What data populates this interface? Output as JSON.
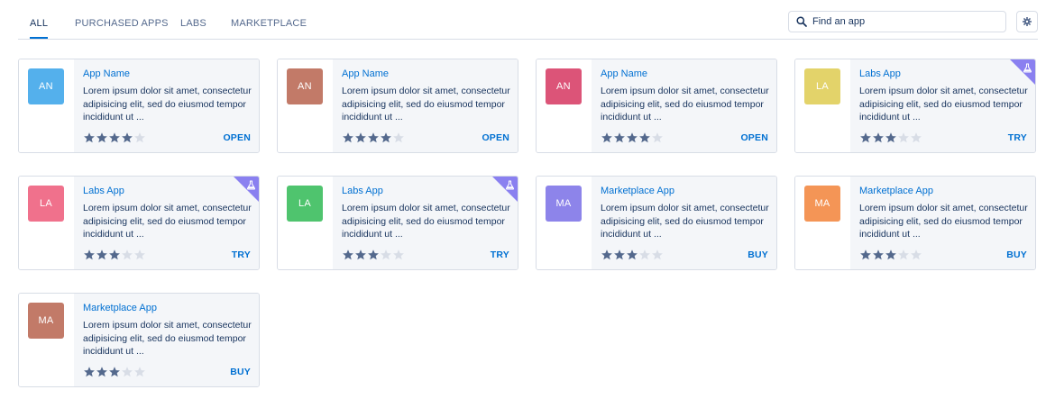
{
  "tabs": [
    {
      "label": "ALL",
      "active": true
    },
    {
      "label": "PURCHASED APPS",
      "active": false
    },
    {
      "label": "LABS",
      "active": false
    },
    {
      "label": "MARKETPLACE",
      "active": false
    }
  ],
  "search": {
    "placeholder": "Find an app"
  },
  "icons": {
    "search": "search-icon",
    "settings": "gear-icon",
    "labs_badge": "flask-icon",
    "rating": "star-icon"
  },
  "colors": {
    "accent": "#0070d2",
    "star_filled": "#54698d",
    "star_empty": "#d8dde6",
    "labs_badge": "#8a80f0"
  },
  "cards": [
    {
      "initials": "AN",
      "color": "#54b0ec",
      "name": "App Name",
      "description": "Lorem ipsum dolor sit amet, consectetur adipisicing elit, sed do eiusmod tempor incididunt ut ...",
      "rating": 4,
      "max_rating": 5,
      "action": "OPEN",
      "labs": false
    },
    {
      "initials": "AN",
      "color": "#c27a68",
      "name": "App Name",
      "description": "Lorem ipsum dolor sit amet, consectetur adipisicing elit, sed do eiusmod tempor incididunt ut ...",
      "rating": 4,
      "max_rating": 5,
      "action": "OPEN",
      "labs": false
    },
    {
      "initials": "AN",
      "color": "#dc5478",
      "name": "App Name",
      "description": "Lorem ipsum dolor sit amet, consectetur adipisicing elit, sed do eiusmod tempor incididunt ut ...",
      "rating": 4,
      "max_rating": 5,
      "action": "OPEN",
      "labs": false
    },
    {
      "initials": "LA",
      "color": "#e3d36a",
      "name": "Labs App",
      "description": "Lorem ipsum dolor sit amet, consectetur adipisicing elit, sed do eiusmod tempor incididunt ut ...",
      "rating": 3,
      "max_rating": 5,
      "action": "TRY",
      "labs": true
    },
    {
      "initials": "LA",
      "color": "#f0718c",
      "name": "Labs App",
      "description": "Lorem ipsum dolor sit amet, consectetur adipisicing elit, sed do eiusmod tempor incididunt ut ...",
      "rating": 3,
      "max_rating": 5,
      "action": "TRY",
      "labs": true
    },
    {
      "initials": "LA",
      "color": "#4fc46e",
      "name": "Labs App",
      "description": "Lorem ipsum dolor sit amet, consectetur adipisicing elit, sed do eiusmod tempor incididunt ut ...",
      "rating": 3,
      "max_rating": 5,
      "action": "TRY",
      "labs": true
    },
    {
      "initials": "MA",
      "color": "#8d84ea",
      "name": "Marketplace App",
      "description": "Lorem ipsum dolor sit amet, consectetur adipisicing elit, sed do eiusmod tempor incididunt ut ...",
      "rating": 3,
      "max_rating": 5,
      "action": "BUY",
      "labs": false
    },
    {
      "initials": "MA",
      "color": "#f49556",
      "name": "Marketplace App",
      "description": "Lorem ipsum dolor sit amet, consectetur adipisicing elit, sed do eiusmod tempor incididunt ut ...",
      "rating": 3,
      "max_rating": 5,
      "action": "BUY",
      "labs": false
    },
    {
      "initials": "MA",
      "color": "#c27a68",
      "name": "Marketplace App",
      "description": "Lorem ipsum dolor sit amet, consectetur adipisicing elit, sed do eiusmod tempor incididunt ut ...",
      "rating": 3,
      "max_rating": 5,
      "action": "BUY",
      "labs": false
    }
  ]
}
